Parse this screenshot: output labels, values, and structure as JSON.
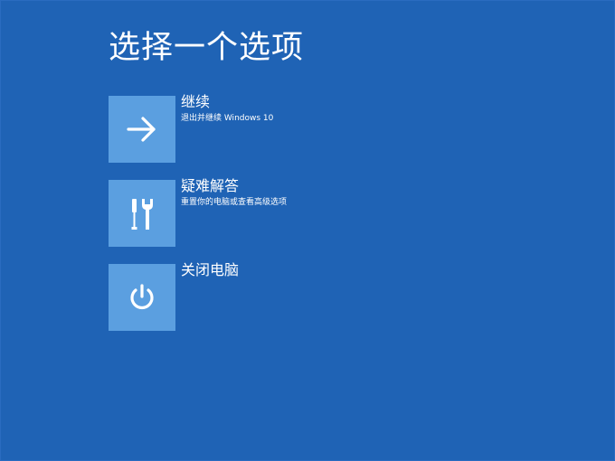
{
  "page": {
    "title": "选择一个选项"
  },
  "options": [
    {
      "label": "继续",
      "description": "退出并继续 Windows 10",
      "icon": "arrow-right-icon"
    },
    {
      "label": "疑难解答",
      "description": "重置你的电脑或查看高级选项",
      "icon": "tools-icon"
    },
    {
      "label": "关闭电脑",
      "description": "",
      "icon": "power-icon"
    }
  ],
  "colors": {
    "background": "#1f63b5",
    "tile": "#5b9fe0",
    "text": "#ffffff"
  }
}
